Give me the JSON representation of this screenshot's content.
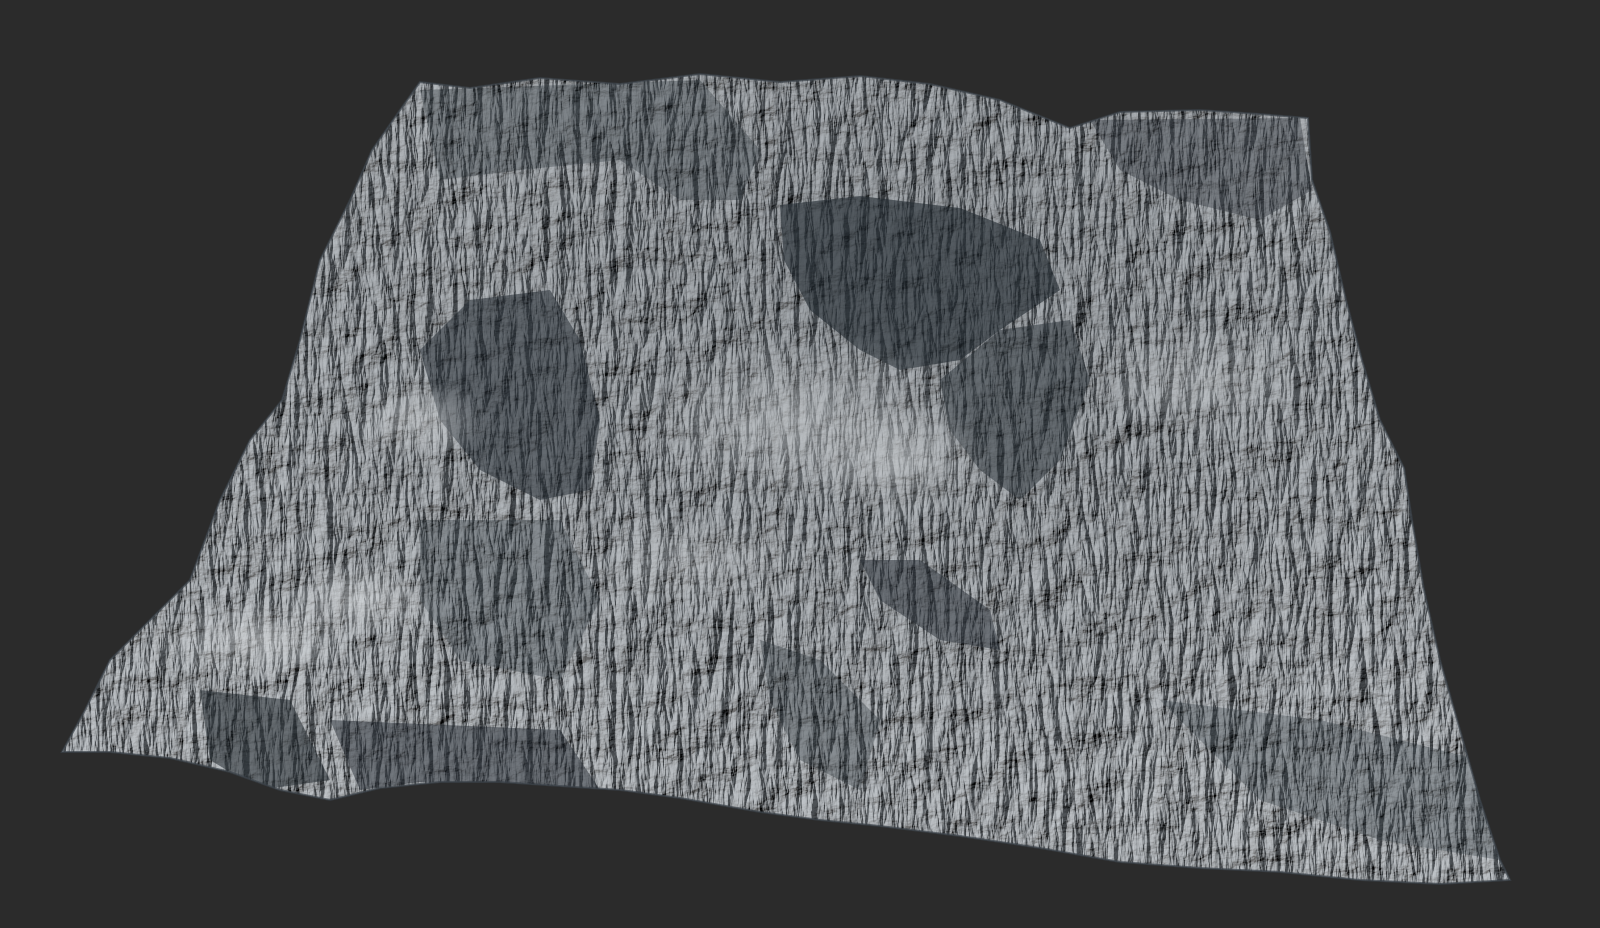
{
  "viewport": {
    "background": "#2b2b2b"
  },
  "terrain": {
    "subject": "terrain-heightmap-render",
    "colors": {
      "base": "#8a9299",
      "highlight": "#d6dadd",
      "mid": "#a9b0b6",
      "shadow": "#3a414a",
      "deep_shadow": "#222930"
    },
    "features": [
      "central-valley",
      "steep-ridges",
      "eroded-slopes",
      "flat-basins"
    ]
  }
}
